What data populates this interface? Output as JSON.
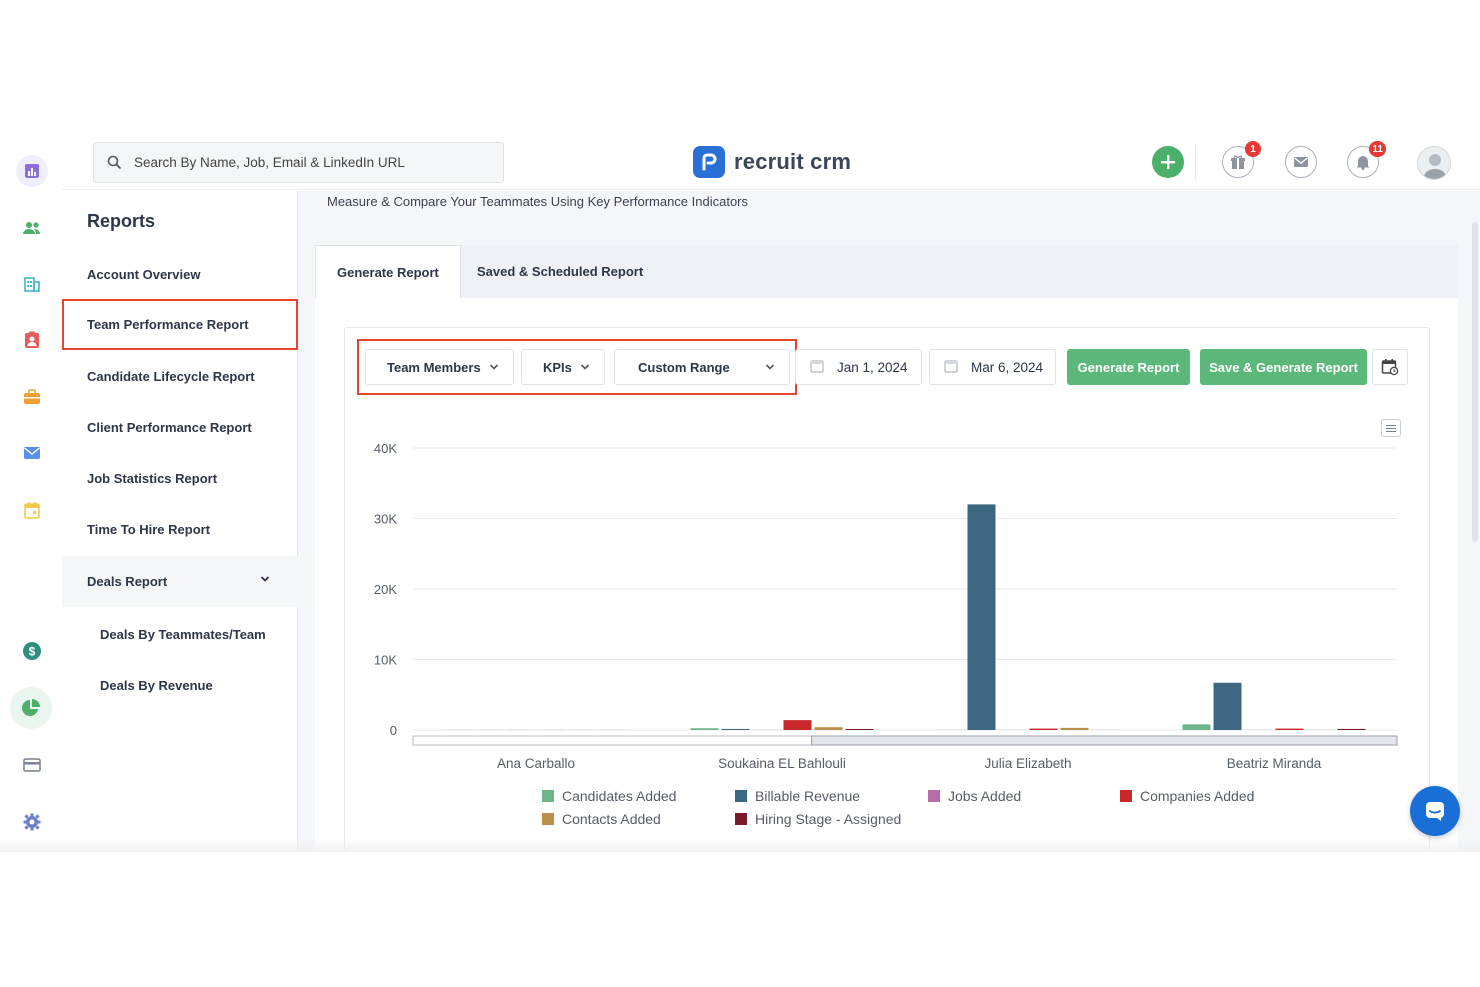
{
  "search": {
    "placeholder": "Search By Name, Job, Email & LinkedIn URL"
  },
  "brand": {
    "name": "recruit crm",
    "color": "#2a6fd6"
  },
  "header": {
    "gift_badge": "1",
    "notification_badge": "11"
  },
  "rail": {
    "icons": [
      "reports-icon",
      "candidates-icon",
      "companies-icon",
      "contacts-icon",
      "jobs-icon",
      "email-icon",
      "calendar-icon",
      "deals-icon",
      "reports-pie-icon",
      "billing-icon",
      "settings-icon"
    ]
  },
  "reports_nav": {
    "title": "Reports",
    "items": [
      {
        "label": "Account Overview"
      },
      {
        "label": "Team Performance Report"
      },
      {
        "label": "Candidate Lifecycle Report"
      },
      {
        "label": "Client Performance Report"
      },
      {
        "label": "Job Statistics Report"
      },
      {
        "label": "Time To Hire Report"
      },
      {
        "label": "Deals Report"
      },
      {
        "label": "Deals By Teammates/Team"
      },
      {
        "label": "Deals By Revenue"
      }
    ]
  },
  "main": {
    "subtitle": "Measure & Compare Your Teammates Using Key Performance Indicators",
    "tabs": [
      {
        "label": "Generate Report"
      },
      {
        "label": "Saved & Scheduled Report"
      }
    ],
    "filters": {
      "team_members": "Team Members",
      "kpis": "KPIs",
      "range": "Custom Range",
      "start_date": "Jan 1, 2024",
      "end_date": "Mar 6, 2024"
    },
    "buttons": {
      "generate": "Generate Report",
      "save_generate": "Save & Generate Report"
    }
  },
  "chart_data": {
    "type": "bar",
    "categories": [
      "Ana Carballo",
      "Soukaina EL Bahlouli",
      "Julia Elizabeth",
      "Beatriz Miranda"
    ],
    "ylim": [
      0,
      40000
    ],
    "yticks": [
      "0",
      "10K",
      "20K",
      "30K",
      "40K"
    ],
    "series": [
      {
        "name": "Candidates Added",
        "color": "#6fb58b",
        "values": [
          0,
          250,
          0,
          800
        ]
      },
      {
        "name": "Billable Revenue",
        "color": "#3d6680",
        "values": [
          0,
          150,
          32000,
          6700
        ]
      },
      {
        "name": "Jobs Added",
        "color": "#b86ba8",
        "values": [
          0,
          0,
          0,
          0
        ]
      },
      {
        "name": "Companies Added",
        "color": "#c8282a",
        "values": [
          0,
          1400,
          200,
          200
        ]
      },
      {
        "name": "Contacts Added",
        "color": "#b9904a",
        "values": [
          0,
          400,
          300,
          0
        ]
      },
      {
        "name": "Hiring Stage - Assigned",
        "color": "#7a1a2a",
        "values": [
          0,
          100,
          0,
          150
        ]
      }
    ]
  }
}
